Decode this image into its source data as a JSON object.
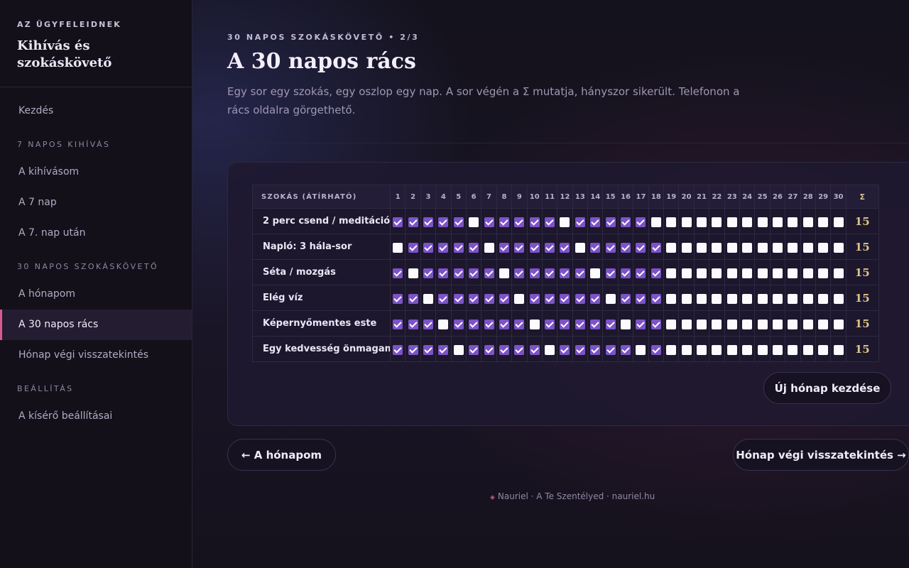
{
  "sidebar": {
    "kicker": "AZ ÜGYFELEIDNEK",
    "title": "Kihívás és szokáskövető",
    "home": "Kezdés",
    "sections": [
      {
        "label": "7 NAPOS KIHÍVÁS",
        "items": [
          "A kihívásom",
          "A 7 nap",
          "A 7. nap után"
        ]
      },
      {
        "label": "30 NAPOS SZOKÁSKÖVETŐ",
        "items": [
          "A hónapom",
          "A 30 napos rács",
          "Hónap végi visszatekintés"
        ]
      },
      {
        "label": "BEÁLLÍTÁS",
        "items": [
          "A kísérő beállításai"
        ]
      }
    ],
    "active_item": "A 30 napos rács"
  },
  "header": {
    "kicker": "30 NAPOS SZOKÁSKÖVETŐ • 2/3",
    "title": "A 30 napos rács",
    "lead": "Egy sor egy szokás, egy oszlop egy nap. A sor végén a Σ mutatja, hányszor sikerült. Telefonon a rács oldalra görgethető."
  },
  "grid": {
    "habit_header": "SZOKÁS (ÁTÍRHATÓ)",
    "days": [
      "1",
      "2",
      "3",
      "4",
      "5",
      "6",
      "7",
      "8",
      "9",
      "10",
      "11",
      "12",
      "13",
      "14",
      "15",
      "16",
      "17",
      "18",
      "19",
      "20",
      "21",
      "22",
      "23",
      "24",
      "25",
      "26",
      "27",
      "28",
      "29",
      "30"
    ],
    "sum_header": "Σ",
    "rows": [
      {
        "habit": "2 perc csend / meditáció",
        "checks": [
          1,
          1,
          1,
          1,
          1,
          0,
          1,
          1,
          1,
          1,
          1,
          0,
          1,
          1,
          1,
          1,
          1,
          0,
          0,
          0,
          0,
          0,
          0,
          0,
          0,
          0,
          0,
          0,
          0,
          0
        ],
        "sum": "15"
      },
      {
        "habit": "Napló: 3 hála-sor",
        "checks": [
          0,
          1,
          1,
          1,
          1,
          1,
          0,
          1,
          1,
          1,
          1,
          1,
          0,
          1,
          1,
          1,
          1,
          1,
          0,
          0,
          0,
          0,
          0,
          0,
          0,
          0,
          0,
          0,
          0,
          0
        ],
        "sum": "15"
      },
      {
        "habit": "Séta / mozgás",
        "checks": [
          1,
          0,
          1,
          1,
          1,
          1,
          1,
          0,
          1,
          1,
          1,
          1,
          1,
          0,
          1,
          1,
          1,
          1,
          0,
          0,
          0,
          0,
          0,
          0,
          0,
          0,
          0,
          0,
          0,
          0
        ],
        "sum": "15"
      },
      {
        "habit": "Elég víz",
        "checks": [
          1,
          1,
          0,
          1,
          1,
          1,
          1,
          1,
          0,
          1,
          1,
          1,
          1,
          1,
          0,
          1,
          1,
          1,
          0,
          0,
          0,
          0,
          0,
          0,
          0,
          0,
          0,
          0,
          0,
          0
        ],
        "sum": "15"
      },
      {
        "habit": "Képernyőmentes este",
        "checks": [
          1,
          1,
          1,
          0,
          1,
          1,
          1,
          1,
          1,
          0,
          1,
          1,
          1,
          1,
          1,
          0,
          1,
          1,
          0,
          0,
          0,
          0,
          0,
          0,
          0,
          0,
          0,
          0,
          0,
          0
        ],
        "sum": "15"
      },
      {
        "habit": "Egy kedvesség önmagamnak",
        "checks": [
          1,
          1,
          1,
          1,
          0,
          1,
          1,
          1,
          1,
          1,
          0,
          1,
          1,
          1,
          1,
          1,
          0,
          1,
          0,
          0,
          0,
          0,
          0,
          0,
          0,
          0,
          0,
          0,
          0,
          0
        ],
        "sum": "15"
      }
    ],
    "new_month_button": "Új hónap kezdése"
  },
  "nav": {
    "prev": "← A hónapom",
    "next": "Hónap végi visszatekintés →"
  },
  "footer": {
    "text": "Nauriel · A Te Szentélyed · nauriel.hu"
  },
  "colors": {
    "accent": "#d85a8e",
    "checked": "#7c53c8",
    "sum": "#dcc48c"
  }
}
